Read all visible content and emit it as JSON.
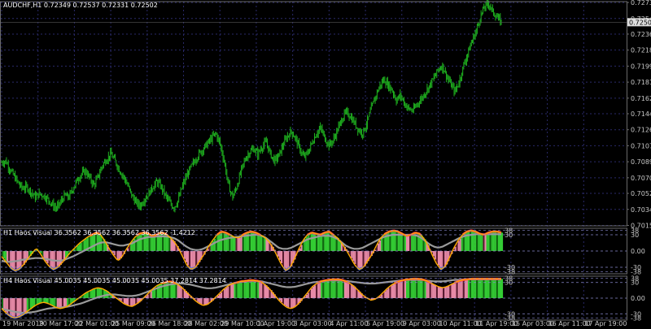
{
  "window": {
    "symbol_header": "AUDCHF,H1  0.72349 0.72537 0.72331 0.72502"
  },
  "colors": {
    "background": "#000000",
    "grid": "#2a2a6a",
    "frame": "#6a6a6a",
    "candle": "#1fb21f",
    "axis_text": "#c8c8c8",
    "bull_fill": "#33cc33",
    "bull_dark": "#116611",
    "bear_fill": "#e88aa8",
    "bear_dark": "#5a1a30",
    "line_red": "#ff2d55",
    "line_orange": "#ffaa00",
    "line_gray": "#9a9a9a",
    "line_blue": "#2255ff",
    "dashed_level": "#8888cc"
  },
  "chart_data": [
    {
      "type": "line",
      "title": "AUDCHF,H1  0.72349 0.72537 0.72331 0.72502",
      "style": "bars",
      "y_ticks": [
        "0.72730",
        "0.72545",
        "0.72365",
        "0.72180",
        "0.71995",
        "0.71810",
        "0.71625",
        "0.71445",
        "0.71260",
        "0.71075",
        "0.70890",
        "0.70705",
        "0.70525",
        "0.70340",
        "0.70155"
      ],
      "ylim": [
        0.7015,
        0.7274
      ],
      "current_price": "0.72502",
      "x_ticks": [
        "19 Mar 2019",
        "20 Mar 17:00",
        "22 Mar 01:00",
        "25 Mar 09:00",
        "26 Mar 18:00",
        "28 Mar 02:00",
        "29 Mar 10:00",
        "1 Apr 19:00",
        "3 Apr 03:00",
        "4 Apr 11:00",
        "5 Apr 19:00",
        "9 Apr 03:00",
        "10 Apr 11:00",
        "11 Apr 19:00",
        "15 Apr 03:00",
        "16 Apr 11:00",
        "17 Apr 19:00"
      ],
      "close_path": [
        [
          0,
          0.7088
        ],
        [
          1,
          0.709
        ],
        [
          2,
          0.708
        ],
        [
          3,
          0.7072
        ],
        [
          4,
          0.7064
        ],
        [
          5,
          0.7058
        ],
        [
          6,
          0.706
        ],
        [
          7,
          0.7054
        ],
        [
          8,
          0.7048
        ],
        [
          9,
          0.7052
        ],
        [
          10,
          0.705
        ],
        [
          11,
          0.7046
        ],
        [
          12,
          0.704
        ],
        [
          13,
          0.7035
        ],
        [
          14,
          0.7042
        ],
        [
          15,
          0.705
        ],
        [
          16,
          0.7048
        ],
        [
          17,
          0.7058
        ],
        [
          18,
          0.7068
        ],
        [
          19,
          0.7075
        ],
        [
          20,
          0.7078
        ],
        [
          21,
          0.707
        ],
        [
          22,
          0.7062
        ],
        [
          23,
          0.7072
        ],
        [
          24,
          0.7085
        ],
        [
          25,
          0.7092
        ],
        [
          26,
          0.7098
        ],
        [
          27,
          0.709
        ],
        [
          28,
          0.708
        ],
        [
          29,
          0.7072
        ],
        [
          30,
          0.7062
        ],
        [
          31,
          0.705
        ],
        [
          32,
          0.7042
        ],
        [
          33,
          0.7038
        ],
        [
          34,
          0.7046
        ],
        [
          35,
          0.7052
        ],
        [
          36,
          0.706
        ],
        [
          37,
          0.7066
        ],
        [
          38,
          0.706
        ],
        [
          39,
          0.705
        ],
        [
          40,
          0.7042
        ],
        [
          41,
          0.7036
        ],
        [
          42,
          0.7044
        ],
        [
          43,
          0.706
        ],
        [
          44,
          0.7072
        ],
        [
          45,
          0.7082
        ],
        [
          46,
          0.709
        ],
        [
          47,
          0.7098
        ],
        [
          48,
          0.7104
        ],
        [
          49,
          0.711
        ],
        [
          50,
          0.7116
        ],
        [
          51,
          0.7122
        ],
        [
          52,
          0.711
        ],
        [
          53,
          0.709
        ],
        [
          54,
          0.7062
        ],
        [
          55,
          0.7048
        ],
        [
          56,
          0.706
        ],
        [
          57,
          0.7078
        ],
        [
          58,
          0.7092
        ],
        [
          59,
          0.71
        ],
        [
          60,
          0.7104
        ],
        [
          61,
          0.7098
        ],
        [
          62,
          0.7106
        ],
        [
          63,
          0.7112
        ],
        [
          64,
          0.7098
        ],
        [
          65,
          0.709
        ],
        [
          66,
          0.7096
        ],
        [
          67,
          0.7108
        ],
        [
          68,
          0.7118
        ],
        [
          69,
          0.7124
        ],
        [
          70,
          0.7116
        ],
        [
          71,
          0.7104
        ],
        [
          72,
          0.7094
        ],
        [
          73,
          0.71
        ],
        [
          74,
          0.7112
        ],
        [
          75,
          0.7122
        ],
        [
          76,
          0.7128
        ],
        [
          77,
          0.7116
        ],
        [
          78,
          0.7108
        ],
        [
          79,
          0.7114
        ],
        [
          80,
          0.7126
        ],
        [
          81,
          0.7138
        ],
        [
          82,
          0.7146
        ],
        [
          83,
          0.7142
        ],
        [
          84,
          0.7134
        ],
        [
          85,
          0.7126
        ],
        [
          86,
          0.7122
        ],
        [
          87,
          0.7134
        ],
        [
          88,
          0.715
        ],
        [
          89,
          0.7164
        ],
        [
          90,
          0.7176
        ],
        [
          91,
          0.7184
        ],
        [
          92,
          0.7178
        ],
        [
          93,
          0.7172
        ],
        [
          94,
          0.716
        ],
        [
          95,
          0.7166
        ],
        [
          96,
          0.7156
        ],
        [
          97,
          0.715
        ],
        [
          98,
          0.7148
        ],
        [
          99,
          0.7156
        ],
        [
          100,
          0.7162
        ],
        [
          101,
          0.717
        ],
        [
          102,
          0.7178
        ],
        [
          103,
          0.7186
        ],
        [
          104,
          0.7196
        ],
        [
          105,
          0.72
        ],
        [
          106,
          0.7188
        ],
        [
          107,
          0.7178
        ],
        [
          108,
          0.717
        ],
        [
          109,
          0.7182
        ],
        [
          110,
          0.72
        ],
        [
          111,
          0.7214
        ],
        [
          112,
          0.7228
        ],
        [
          113,
          0.724
        ],
        [
          114,
          0.7256
        ],
        [
          115,
          0.7268
        ],
        [
          116,
          0.7272
        ],
        [
          117,
          0.7262
        ],
        [
          118,
          0.7256
        ],
        [
          119,
          0.725
        ]
      ]
    },
    {
      "type": "area",
      "title": "H1 Haos Visual 36.3562 36.3562 36.3562 36.3562 -1.4212",
      "levels_left": [
        "38",
        "30",
        "-30",
        "-38"
      ],
      "levels_right": [
        "38",
        "30",
        "0.00",
        "-30",
        "-38"
      ],
      "ylim": [
        -42,
        42
      ],
      "oscillator": [
        -10,
        -20,
        -30,
        -36,
        -34,
        -26,
        -15,
        -5,
        5,
        -5,
        -18,
        -28,
        -34,
        -30,
        -22,
        -12,
        -2,
        6,
        14,
        20,
        26,
        30,
        34,
        30,
        18,
        4,
        -8,
        -18,
        -10,
        4,
        16,
        26,
        32,
        34,
        32,
        28,
        30,
        34,
        32,
        26,
        18,
        6,
        -10,
        -26,
        -34,
        -30,
        -18,
        -6,
        8,
        20,
        30,
        36,
        34,
        30,
        26,
        24,
        30,
        34,
        36,
        34,
        30,
        26,
        18,
        6,
        -10,
        -26,
        -36,
        -30,
        -14,
        4,
        20,
        30,
        34,
        32,
        30,
        34,
        36,
        30,
        24,
        14,
        2,
        -12,
        -26,
        -34,
        -30,
        -18,
        -6,
        10,
        24,
        32,
        36,
        38,
        36,
        32,
        28,
        30,
        34,
        32,
        24,
        10,
        -8,
        -24,
        -34,
        -28,
        -12,
        6,
        20,
        30,
        36,
        38,
        36,
        32,
        30,
        34,
        36,
        36,
        34
      ],
      "trend": [
        -18,
        -20,
        -20,
        -19,
        -18,
        -16,
        -15,
        -14,
        -13,
        -13,
        -14,
        -15,
        -17,
        -18,
        -18,
        -16,
        -13,
        -10,
        -6,
        -2,
        2,
        6,
        10,
        14,
        16,
        16,
        14,
        12,
        10,
        10,
        12,
        14,
        18,
        22,
        24,
        26,
        26,
        27,
        27,
        27,
        26,
        24,
        20,
        14,
        8,
        4,
        2,
        2,
        4,
        8,
        12,
        16,
        20,
        22,
        24,
        25,
        26,
        27,
        28,
        29,
        30,
        30,
        28,
        24,
        18,
        12,
        6,
        4,
        4,
        6,
        10,
        14,
        18,
        22,
        24,
        26,
        28,
        28,
        28,
        26,
        22,
        16,
        10,
        6,
        4,
        4,
        6,
        10,
        14,
        18,
        22,
        26,
        28,
        30,
        30,
        30,
        30,
        30,
        30,
        28,
        24,
        18,
        12,
        8,
        6,
        8,
        12,
        16,
        20,
        24,
        27,
        29,
        30,
        31,
        31,
        31,
        31,
        31,
        31,
        31
      ]
    },
    {
      "type": "area",
      "title": "H4 Haos Visual 45.0035 45.0035 45.0035 45.0035 37.2814 37.2814",
      "levels_left": [
        "38",
        "30",
        "-30",
        "-38"
      ],
      "levels_right": [
        "38",
        "30",
        "0.00",
        "-30",
        "-38"
      ],
      "ylim": [
        -42,
        42
      ],
      "oscillator": [
        -20,
        -28,
        -34,
        -38,
        -36,
        -32,
        -26,
        -20,
        -14,
        -10,
        -8,
        -10,
        -14,
        -18,
        -20,
        -18,
        -14,
        -8,
        -2,
        4,
        10,
        14,
        18,
        20,
        18,
        14,
        8,
        2,
        -4,
        -10,
        -14,
        -16,
        -12,
        -6,
        2,
        10,
        18,
        24,
        28,
        30,
        32,
        30,
        26,
        20,
        12,
        4,
        -4,
        -10,
        -14,
        -12,
        -6,
        2,
        10,
        18,
        24,
        28,
        30,
        32,
        33,
        34,
        34,
        33,
        30,
        24,
        16,
        6,
        -4,
        -12,
        -18,
        -20,
        -16,
        -8,
        2,
        12,
        22,
        28,
        32,
        34,
        35,
        36,
        36,
        35,
        32,
        28,
        22,
        14,
        6,
        0,
        -4,
        -2,
        4,
        12,
        20,
        26,
        30,
        33,
        35,
        36,
        37,
        37,
        36,
        34,
        30,
        26,
        22,
        20,
        22,
        26,
        30,
        33,
        35,
        36,
        37,
        37,
        37,
        37,
        37,
        37,
        37,
        37
      ],
      "trend": [
        -20,
        -22,
        -24,
        -26,
        -27,
        -28,
        -28,
        -27,
        -26,
        -24,
        -22,
        -20,
        -19,
        -18,
        -18,
        -17,
        -16,
        -14,
        -12,
        -10,
        -7,
        -4,
        -1,
        2,
        4,
        6,
        7,
        7,
        6,
        5,
        4,
        4,
        5,
        7,
        10,
        13,
        16,
        19,
        22,
        24,
        26,
        27,
        28,
        28,
        27,
        26,
        24,
        22,
        20,
        19,
        19,
        20,
        22,
        24,
        26,
        28,
        30,
        31,
        32,
        33,
        33,
        33,
        32,
        30,
        28,
        26,
        24,
        22,
        21,
        21,
        22,
        24,
        26,
        28,
        30,
        31,
        32,
        33,
        34,
        34,
        34,
        34,
        33,
        32,
        31,
        30,
        29,
        28,
        28,
        28,
        29,
        30,
        31,
        32,
        33,
        34,
        35,
        35,
        35,
        35,
        35,
        34,
        33,
        32,
        32,
        32,
        33,
        34,
        35,
        35,
        36,
        36,
        36,
        36,
        36,
        36,
        36,
        36,
        36,
        36
      ]
    }
  ]
}
